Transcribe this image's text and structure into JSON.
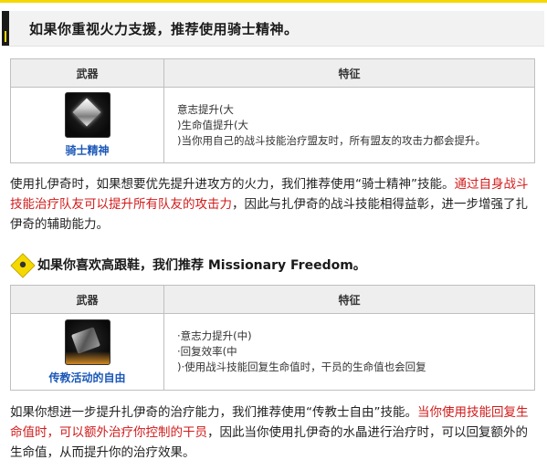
{
  "section1": {
    "heading": "如果你重视火力支援，推荐使用骑士精神。",
    "table": {
      "col_weapon": "武器",
      "col_feature": "特征",
      "weapon_name": "骑士精神",
      "features": [
        "意志提升(大",
        ")生命值提升(大",
        ")当你用自己的战斗技能治疗盟友时，所有盟友的攻击力都会提升。"
      ]
    },
    "para": {
      "text1": "使用扎伊奇时，如果想要优先提升进攻方的火力，我们推荐使用“骑士精神”技能。",
      "red": "通过自身战斗技能治疗队友可以提升所有队友的攻击力",
      "text2": "，因此与扎伊奇的战斗技能相得益彰，进一步增强了扎伊奇的辅助能力。"
    }
  },
  "section2": {
    "heading": "如果你喜欢高跟鞋，我们推荐 Missionary Freedom。",
    "table": {
      "col_weapon": "武器",
      "col_feature": "特征",
      "weapon_name": "传教活动的自由",
      "features": [
        "·意志力提升(中)",
        "·回复效率(中",
        ")·使用战斗技能回复生命值时，干员的生命值也会回复"
      ]
    },
    "para": {
      "text1": "如果你想进一步提升扎伊奇的治疗能力，我们推荐使用“传教士自由”技能。",
      "red": "当你使用技能回复生命值时，可以额外治疗你控制的干员",
      "text2": "，因此当你使用扎伊奇的水晶进行治疗时，可以回复额外的生命值，从而提升你的治疗效果。"
    }
  },
  "colors": {
    "accent": "#f5d800",
    "link": "#1a57b8",
    "highlight": "#d21a1a"
  },
  "icons": {
    "heading1": "yellow-bar-icon",
    "heading2": "diamond-badge-icon",
    "weapon1": "crystal-gem-icon",
    "weapon2": "mechanical-relic-icon"
  }
}
